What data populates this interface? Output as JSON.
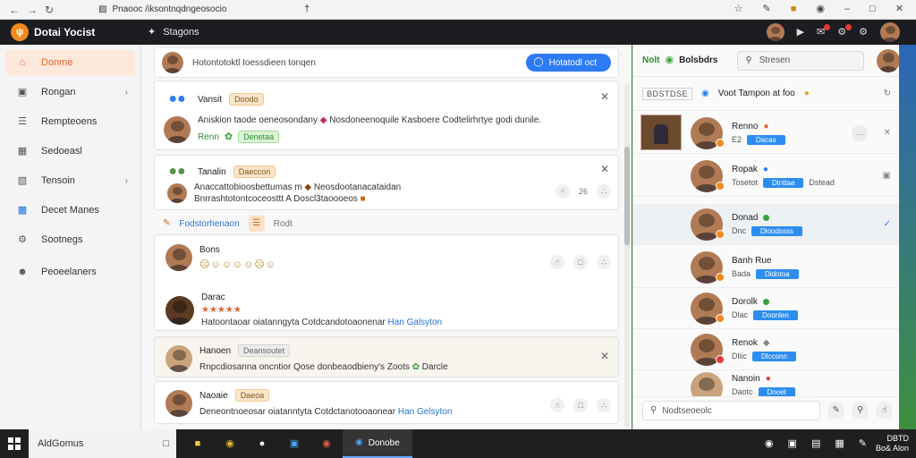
{
  "browser": {
    "url": "Pnaooc /iksontnqdngeosocio",
    "cursor_glyph": "•"
  },
  "app": {
    "name": "Dotai Yocist",
    "logo_glyph": "ψ",
    "search_label": "Stagons"
  },
  "sidebar": {
    "items": [
      {
        "label": "Donme",
        "icon": "home-icon",
        "active": true
      },
      {
        "label": "Rongan",
        "icon": "monitor-icon",
        "chevron": true
      },
      {
        "label": "Rempteoens",
        "icon": "list-icon"
      },
      {
        "label": "Sedoeasl",
        "icon": "chart-icon"
      },
      {
        "label": "Tensoin",
        "icon": "folder-icon",
        "chevron": true
      },
      {
        "label": "Decet Manes",
        "icon": "doc-icon"
      },
      {
        "label": "Sootnegs",
        "icon": "gear-icon"
      },
      {
        "label": "Peoeelaners",
        "icon": "people-icon"
      }
    ]
  },
  "feed": {
    "composer_prompt": "Hotontotoktl Ioessdieen tonqen",
    "composer_cta": "Hotatodl oct",
    "posts": [
      {
        "name": "Vansit",
        "pill": "Doodo",
        "text": "Aniskion taode oeneosondany",
        "text2": "Nosdoneenoquile Kasboere Codtelirhrtye godi dunile.",
        "sub_name": "Renn",
        "sub_pill": "Denetaa"
      },
      {
        "name": "Tanalin",
        "pill": "Daeccon",
        "text": "Anaccattobioosbettumas m",
        "text2": "Neosdootanacataidan",
        "text3": "Bnrrashtotontcoceosttt A Doscl3taoooeos",
        "count": "26"
      },
      {
        "name": "Bons",
        "count_glyphs": "☹☺☺☺☺☹☺"
      },
      {
        "name": "Darac",
        "stars": "★★★★★",
        "text": "Hatoontaoar oiatanngyta Cotdcandotoaonenar",
        "link": "Han Galsyton"
      },
      {
        "name": "Hanoen",
        "pill": "Deansoutet",
        "text": "Rnpcdiosanna oncntior Qose donbeaodbieny's Zoots",
        "tail": "Darcle"
      },
      {
        "name": "Naoaie",
        "pill": "Daeoa",
        "text": "Deneontnoeosar oiatanntyta Cotdctanotooaonear",
        "link": "Han Gelsyton"
      }
    ],
    "section": {
      "label": "Fodstorhenaon",
      "rank": "Rodt"
    }
  },
  "rpanel": {
    "title_green": "Nolt",
    "title": "Bolsbdrs",
    "search": "Stresen",
    "sub_tab": "BDSTDSE",
    "sub_title": "Voot Tampon at foo",
    "contacts": [
      {
        "name": "Renno",
        "badge": "Dacas",
        "meta2": "E2",
        "presence": "orange"
      },
      {
        "name": "Ropak",
        "meta": "Tosetot",
        "badge": "Dlnttaa",
        "meta2": "Dstead",
        "presence": "orange"
      },
      {
        "name": "Donad",
        "meta": "Dnc",
        "badge": "Dloodssss",
        "presence": "orange",
        "selected": true
      },
      {
        "name": "Banh Rue",
        "meta": "Bada",
        "badge": "Dldotoa",
        "presence": "orange"
      },
      {
        "name": "Dorolk",
        "meta": "Dlac",
        "badge": "Doonlen",
        "presence": "orange"
      },
      {
        "name": "Renok",
        "meta": "Dliic",
        "badge": "Dlcconn",
        "presence": "red"
      },
      {
        "name": "Nanoin",
        "meta": "Daotc",
        "badge": "Dnoet",
        "presence": "orange"
      }
    ],
    "footer_input": "Nodtseoeolc"
  },
  "taskbar": {
    "search": "AldGomus",
    "active_app": "Donobe",
    "clock_line1": "DBTD",
    "clock_line2": "Bo& Alon"
  },
  "colors": {
    "accent_orange": "#e2662b",
    "primary_blue": "#2d7bf4",
    "header_dark": "#1c1d20"
  }
}
